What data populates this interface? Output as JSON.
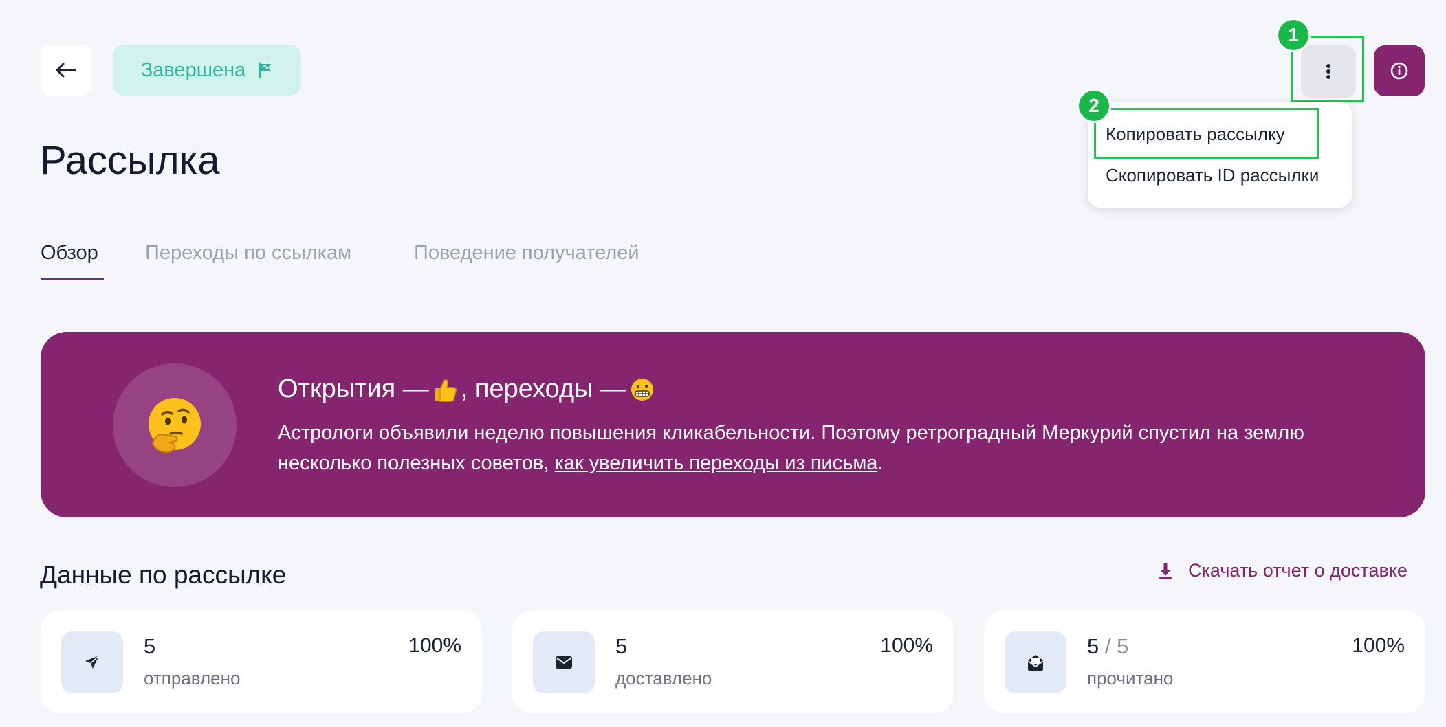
{
  "header": {
    "back_label": "←",
    "status": "Завершена",
    "status_color": "#2bb59c",
    "accent_color": "#85256f"
  },
  "annotations": {
    "badge1": "1",
    "badge2": "2",
    "highlight_color": "#1fc44f"
  },
  "menu": {
    "items": [
      {
        "label": "Копировать рассылку"
      },
      {
        "label": "Скопировать ID рассылки"
      }
    ]
  },
  "page": {
    "title": "Рассылка"
  },
  "tabs": [
    {
      "label": "Обзор",
      "active": true
    },
    {
      "label": "Переходы по ссылкам",
      "active": false
    },
    {
      "label": "Поведение получателей",
      "active": false
    }
  ],
  "banner": {
    "title_part1": "Открытия —",
    "title_part2": ", переходы —",
    "text": "Астрологи объявили неделю повышения кликабельности. Поэтому ретроградный Меркурий спустил на землю несколько полезных советов, ",
    "link": "как увеличить переходы из письма",
    "text_end": ".",
    "icons": [
      "thinking-face-emoji",
      "thumbs-up-emoji",
      "grimacing-face-emoji"
    ]
  },
  "section": {
    "title": "Данные по рассылке",
    "download": "Скачать отчет о доставке"
  },
  "stats": [
    {
      "icon": "send-icon",
      "value": "5",
      "value_extra": "",
      "label": "отправлено",
      "percent": "100%"
    },
    {
      "icon": "envelope-icon",
      "value": "5",
      "value_extra": "",
      "label": "доставлено",
      "percent": "100%"
    },
    {
      "icon": "open-envelope-icon",
      "value": "5",
      "value_extra": " / 5",
      "label": "прочитано",
      "percent": "100%"
    }
  ]
}
